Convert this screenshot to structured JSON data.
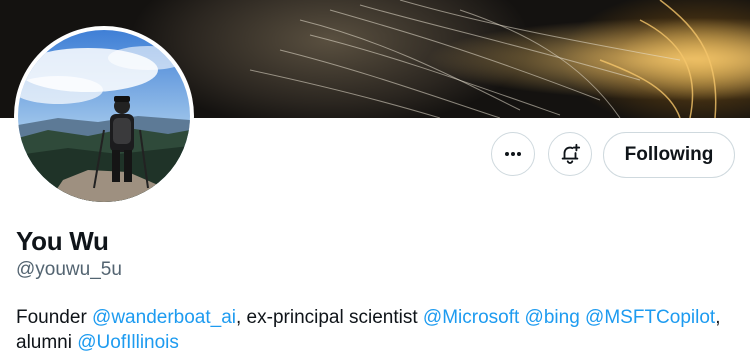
{
  "profile": {
    "name": "You Wu",
    "handle": "@youwu_5u",
    "bio": {
      "prefix": "Founder ",
      "mention_wanderboat": "@wanderboat_ai",
      "middle": ", ex-principal scientist ",
      "mention_microsoft": "@Microsoft",
      "mention_bing": "@bing",
      "mention_copilot": "@MSFTCopilot",
      "line2_prefix": "alumni ",
      "mention_illinois": "@UofIllinois"
    }
  },
  "actions": {
    "more_icon": "more-horizontal-icon",
    "notify_icon": "bell-plus-icon",
    "follow_label": "Following"
  },
  "colors": {
    "link": "#1d9bf0",
    "text": "#0f1419",
    "muted": "#536471",
    "border": "#cfd9de"
  }
}
